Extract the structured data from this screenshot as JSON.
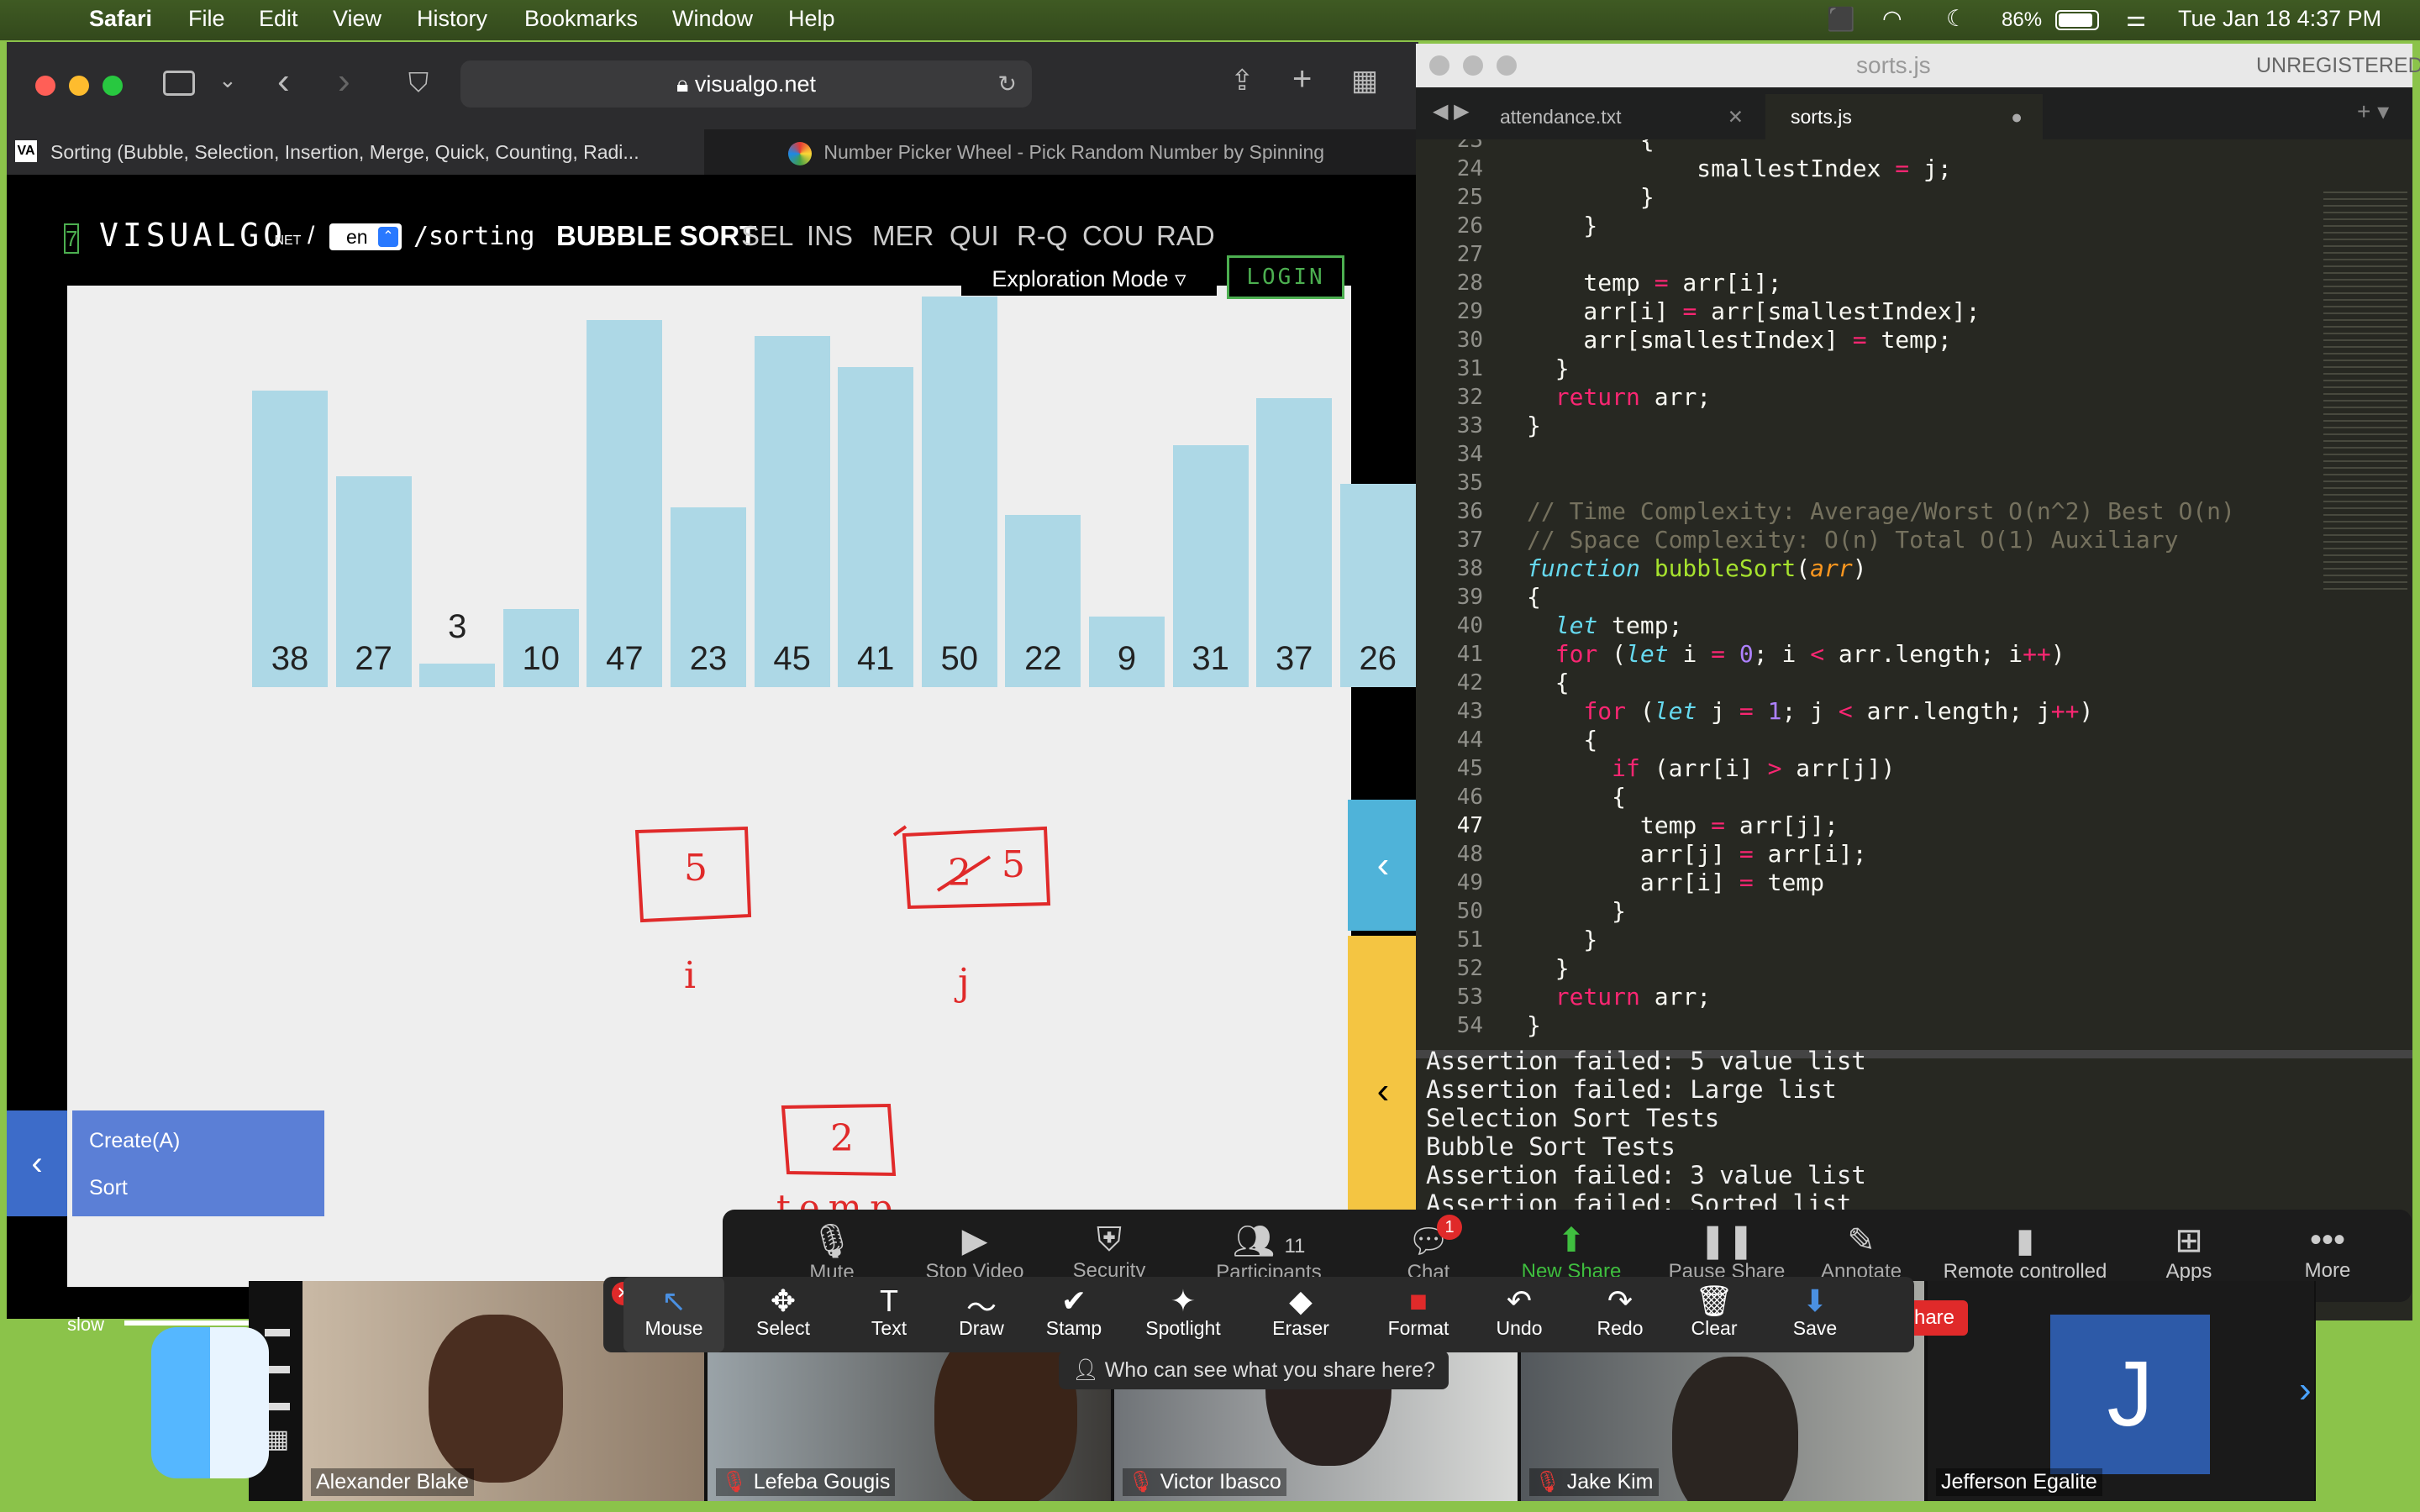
{
  "menubar": {
    "app": "Safari",
    "items": [
      "File",
      "Edit",
      "View",
      "History",
      "Bookmarks",
      "Window",
      "Help"
    ],
    "battery": "86%",
    "clock": "Tue Jan 18  4:37 PM"
  },
  "safari": {
    "url": "visualgo.net",
    "tabs": [
      {
        "title": "Sorting (Bubble, Selection, Insertion, Merge, Quick, Counting, Radi..."
      },
      {
        "title": "Number Picker Wheel - Pick Random Number by Spinning"
      }
    ]
  },
  "visualgo": {
    "logo": "VISUALGO",
    "logo_suffix": ".NET",
    "slash": "/",
    "lang": "en",
    "path": "/sorting",
    "algos": [
      "BUBBLE SORT",
      "SEL",
      "INS",
      "MER",
      "QUI",
      "R-Q",
      "COU",
      "RAD"
    ],
    "mode": "Exploration Mode",
    "login": "LOGIN",
    "values": [
      38,
      27,
      3,
      10,
      47,
      23,
      45,
      41,
      50,
      22,
      9,
      31,
      37,
      26
    ],
    "menu": [
      "Create(A)",
      "Sort"
    ],
    "speed": "slow"
  },
  "annotations": {
    "box1": "5",
    "label1": "i",
    "box2_struck": "2",
    "box2": "5",
    "label2": "j",
    "box3": "2",
    "label3": "temp"
  },
  "sublime": {
    "title": "sorts.js",
    "status": "UNREGISTERED",
    "tabs": [
      "attendance.txt",
      "sorts.js"
    ],
    "console": [
      "Assertion failed: 5 value list",
      "Assertion failed: Large list",
      "Selection Sort Tests",
      "Bubble Sort Tests",
      "Assertion failed: 3 value list",
      "Assertion failed: Sorted list"
    ]
  },
  "zoom": {
    "toolbar": [
      "Mute",
      "Stop Video",
      "Security",
      "Participants",
      "Chat",
      "New Share",
      "Pause Share",
      "Annotate",
      "Remote controlled",
      "Apps",
      "More"
    ],
    "participants_count": "11",
    "chat_badge": "1",
    "annotate_tools": [
      "Mouse",
      "Select",
      "Text",
      "Draw",
      "Stamp",
      "Spotlight",
      "Eraser",
      "Format",
      "Undo",
      "Redo",
      "Clear",
      "Save"
    ],
    "share_hint": "Who can see what you share here?",
    "share_badge": "hare",
    "participants": [
      "Alexander Blake",
      "Lefeba Gougis",
      "Victor Ibasco",
      "Jake Kim",
      "Jefferson Egalite"
    ],
    "avatar_initial": "J"
  }
}
